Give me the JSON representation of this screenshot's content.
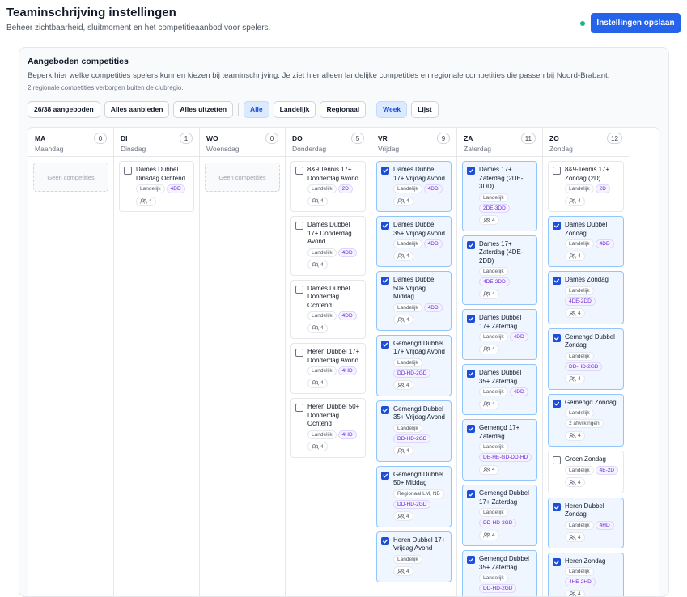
{
  "header": {
    "title": "Teaminschrijving instellingen",
    "subtitle": "Beheer zichtbaarheid, sluitmoment en het competitieaanbod voor spelers.",
    "save_label": "Instellingen opslaan",
    "status_color": "#10b981"
  },
  "section": {
    "title": "Aangeboden competities",
    "description": "Beperk hier welke competities spelers kunnen kiezen bij teaminschrijving. Je ziet hier alleen landelijke competities en regionale competities die passen bij Noord-Brabant.",
    "note": "2 regionale competities verborgen buiten de clubregio."
  },
  "toolbar": {
    "count_label": "26/38 aangeboden",
    "offer_all": "Alles aanbieden",
    "exclude_all": "Alles uitzetten",
    "filter_all": "Alle",
    "filter_national": "Landelijk",
    "filter_regional": "Regionaal",
    "view_week": "Week",
    "view_list": "Lijst"
  },
  "empty_label": "Geen competities",
  "columns": [
    {
      "short": "MA",
      "long": "Maandag",
      "count": "0",
      "cards": []
    },
    {
      "short": "DI",
      "long": "Dinsdag",
      "count": "1",
      "cards": [
        {
          "name": "Dames Dubbel Dinsdag Ochtend",
          "checked": false,
          "tags": [
            {
              "t": "Landelijk"
            },
            {
              "t": "4DD",
              "p": true
            }
          ],
          "teams": "4"
        }
      ]
    },
    {
      "short": "WO",
      "long": "Woensdag",
      "count": "0",
      "cards": []
    },
    {
      "short": "DO",
      "long": "Donderdag",
      "count": "5",
      "cards": [
        {
          "name": "8&9 Tennis 17+ Donderdag Avond",
          "checked": false,
          "tags": [
            {
              "t": "Landelijk"
            },
            {
              "t": "2D",
              "p": true
            }
          ],
          "teams": "4"
        },
        {
          "name": "Dames Dubbel 17+ Donderdag Avond",
          "checked": false,
          "tags": [
            {
              "t": "Landelijk"
            },
            {
              "t": "4DD",
              "p": true
            }
          ],
          "teams": "4"
        },
        {
          "name": "Dames Dubbel Donderdag Ochtend",
          "checked": false,
          "tags": [
            {
              "t": "Landelijk"
            },
            {
              "t": "4DD",
              "p": true
            }
          ],
          "teams": "4"
        },
        {
          "name": "Heren Dubbel 17+ Donderdag Avond",
          "checked": false,
          "tags": [
            {
              "t": "Landelijk"
            },
            {
              "t": "4HD",
              "p": true
            }
          ],
          "teams": "4"
        },
        {
          "name": "Heren Dubbel 50+ Donderdag Ochtend",
          "checked": false,
          "tags": [
            {
              "t": "Landelijk"
            },
            {
              "t": "4HD",
              "p": true
            }
          ],
          "teams": "4"
        }
      ]
    },
    {
      "short": "VR",
      "long": "Vrijdag",
      "count": "9",
      "cards": [
        {
          "name": "Dames Dubbel 17+ Vrijdag Avond",
          "checked": true,
          "tags": [
            {
              "t": "Landelijk"
            },
            {
              "t": "4DD",
              "p": true
            }
          ],
          "teams": "4"
        },
        {
          "name": "Dames Dubbel 35+ Vrijdag Avond",
          "checked": true,
          "tags": [
            {
              "t": "Landelijk"
            },
            {
              "t": "4DD",
              "p": true
            }
          ],
          "teams": "4"
        },
        {
          "name": "Dames Dubbel 50+ Vrijdag Middag",
          "checked": true,
          "tags": [
            {
              "t": "Landelijk"
            },
            {
              "t": "4DD",
              "p": true
            }
          ],
          "teams": "4"
        },
        {
          "name": "Gemengd Dubbel 17+ Vrijdag Avond",
          "checked": true,
          "tags": [
            {
              "t": "Landelijk"
            },
            {
              "t": "DD-HD-2GD",
              "p": true
            }
          ],
          "teams": "4"
        },
        {
          "name": "Gemengd Dubbel 35+ Vrijdag Avond",
          "checked": true,
          "tags": [
            {
              "t": "Landelijk"
            },
            {
              "t": "DD-HD-2GD",
              "p": true
            }
          ],
          "teams": "4"
        },
        {
          "name": "Gemengd Dubbel 50+ Middag",
          "checked": true,
          "tags": [
            {
              "t": "Regionaal LM, NB"
            },
            {
              "t": "DD-HD-2GD",
              "p": true
            }
          ],
          "teams": "4"
        },
        {
          "name": "Heren Dubbel 17+ Vrijdag Avond",
          "checked": true,
          "tags": [
            {
              "t": "Landelijk"
            }
          ],
          "teams": "4"
        }
      ]
    },
    {
      "short": "ZA",
      "long": "Zaterdag",
      "count": "11",
      "cards": [
        {
          "name": "Dames 17+ Zaterdag (2DE-3DD)",
          "checked": true,
          "tags": [
            {
              "t": "Landelijk"
            },
            {
              "t": "2DE-3DD",
              "p": true
            }
          ],
          "teams": "4"
        },
        {
          "name": "Dames 17+ Zaterdag (4DE-2DD)",
          "checked": true,
          "tags": [
            {
              "t": "Landelijk"
            },
            {
              "t": "4DE-2DD",
              "p": true
            }
          ],
          "teams": "4"
        },
        {
          "name": "Dames Dubbel 17+ Zaterdag",
          "checked": true,
          "tags": [
            {
              "t": "Landelijk"
            },
            {
              "t": "4DD",
              "p": true
            }
          ],
          "teams": "4"
        },
        {
          "name": "Dames Dubbel 35+ Zaterdag",
          "checked": true,
          "tags": [
            {
              "t": "Landelijk"
            },
            {
              "t": "4DD",
              "p": true
            }
          ],
          "teams": "4"
        },
        {
          "name": "Gemengd 17+ Zaterdag",
          "checked": true,
          "tags": [
            {
              "t": "Landelijk"
            },
            {
              "t": "DE-HE-GD-DD-HD",
              "p": true
            }
          ],
          "teams": "4"
        },
        {
          "name": "Gemengd Dubbel 17+ Zaterdag",
          "checked": true,
          "tags": [
            {
              "t": "Landelijk"
            },
            {
              "t": "DD-HD-2GD",
              "p": true
            }
          ],
          "teams": "4"
        },
        {
          "name": "Gemengd Dubbel 35+ Zaterdag",
          "checked": true,
          "tags": [
            {
              "t": "Landelijk"
            },
            {
              "t": "DD-HD-2GD",
              "p": true
            }
          ],
          "teams": "4"
        }
      ]
    },
    {
      "short": "ZO",
      "long": "Zondag",
      "count": "12",
      "cards": [
        {
          "name": "8&9-Tennis 17+ Zondag (2D)",
          "checked": false,
          "tags": [
            {
              "t": "Landelijk"
            },
            {
              "t": "2D",
              "p": true
            }
          ],
          "teams": "4"
        },
        {
          "name": "Dames Dubbel Zondag",
          "checked": true,
          "tags": [
            {
              "t": "Landelijk"
            },
            {
              "t": "4DD",
              "p": true
            }
          ],
          "teams": "4"
        },
        {
          "name": "Dames Zondag",
          "checked": true,
          "tags": [
            {
              "t": "Landelijk"
            },
            {
              "t": "4DE-2DD",
              "p": true
            }
          ],
          "teams": "4"
        },
        {
          "name": "Gemengd Dubbel Zondag",
          "checked": true,
          "tags": [
            {
              "t": "Landelijk"
            },
            {
              "t": "DD-HD-2GD",
              "p": true
            }
          ],
          "teams": "4"
        },
        {
          "name": "Gemengd Zondag",
          "checked": true,
          "tags": [
            {
              "t": "Landelijk"
            },
            {
              "t": "2 afwijkingen"
            }
          ],
          "teams": "4"
        },
        {
          "name": "Groen Zondag",
          "checked": false,
          "tags": [
            {
              "t": "Landelijk"
            },
            {
              "t": "4E-2D",
              "p": true
            }
          ],
          "teams": "4"
        },
        {
          "name": "Heren Dubbel Zondag",
          "checked": true,
          "tags": [
            {
              "t": "Landelijk"
            },
            {
              "t": "4HD",
              "p": true
            }
          ],
          "teams": "4"
        },
        {
          "name": "Heren Zondag",
          "checked": true,
          "tags": [
            {
              "t": "Landelijk"
            },
            {
              "t": "4HE-2HD",
              "p": true
            }
          ],
          "teams": "4"
        }
      ]
    }
  ]
}
